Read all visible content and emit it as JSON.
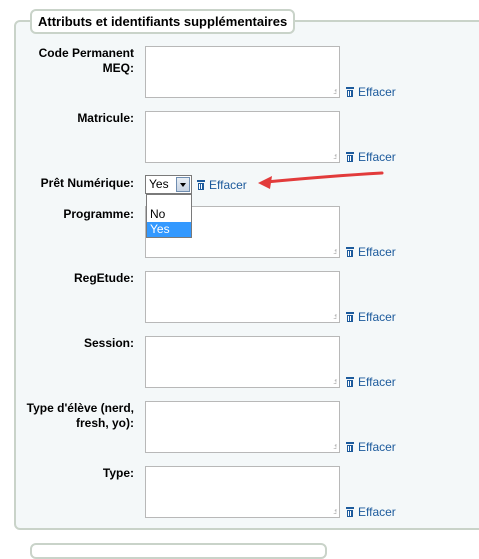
{
  "legend": "Attributs et identifiants supplémentaires",
  "clear_label": "Effacer",
  "fields": [
    {
      "label": "Code Permanent MEQ:"
    },
    {
      "label": "Matricule:"
    },
    {
      "label": "Prêt Numérique:"
    },
    {
      "label": "Programme:"
    },
    {
      "label": "RegEtude:"
    },
    {
      "label": "Session:"
    },
    {
      "label": "Type d'élève (nerd, fresh, yo):"
    },
    {
      "label": "Type:"
    }
  ],
  "select": {
    "value": "Yes",
    "options": [
      "No",
      "Yes"
    ],
    "highlighted": "Yes"
  },
  "colors": {
    "link": "#1c5a9c",
    "annotation_arrow": "#e23b3b",
    "highlight": "#3399ff"
  }
}
